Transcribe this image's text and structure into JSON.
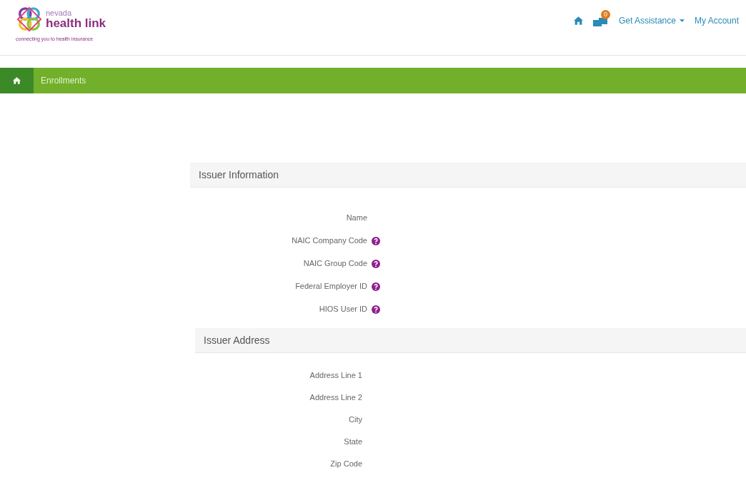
{
  "logo": {
    "small": "nevada",
    "name": "health link",
    "tagline": "connecting you to health insurance"
  },
  "nav": {
    "badge": "0",
    "items": [
      {
        "label": "Get Assistance",
        "dropdown": true
      },
      {
        "label": "My Account",
        "dropdown": false
      }
    ]
  },
  "breadcrumb": {
    "label": "Enrollments"
  },
  "sections": [
    {
      "title": "Issuer Information",
      "fields": [
        {
          "label": "Name",
          "help": false
        },
        {
          "label": "NAIC Company Code",
          "help": true
        },
        {
          "label": "NAIC Group Code",
          "help": true
        },
        {
          "label": "Federal Employer ID",
          "help": true
        },
        {
          "label": "HIOS User ID",
          "help": true
        }
      ]
    },
    {
      "title": "Issuer Address",
      "fields": [
        {
          "label": "Address Line 1",
          "help": false
        },
        {
          "label": "Address Line 2",
          "help": false
        },
        {
          "label": "City",
          "help": false
        },
        {
          "label": "State",
          "help": false
        },
        {
          "label": "Zip Code",
          "help": false
        }
      ]
    }
  ]
}
